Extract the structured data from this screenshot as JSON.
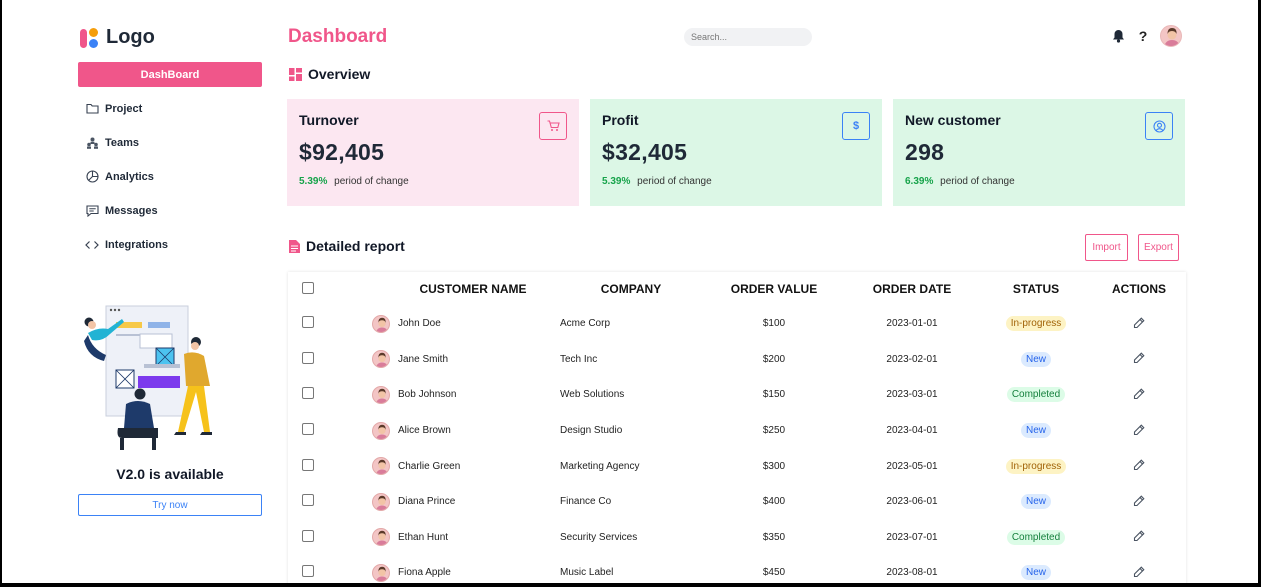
{
  "logo": {
    "text": "Logo"
  },
  "sidebar": {
    "items": [
      {
        "label": "DashBoard",
        "icon": "dashboard-icon",
        "active": true
      },
      {
        "label": "Project",
        "icon": "folder-icon"
      },
      {
        "label": "Teams",
        "icon": "teams-icon"
      },
      {
        "label": "Analytics",
        "icon": "pie-chart-icon"
      },
      {
        "label": "Messages",
        "icon": "message-icon"
      },
      {
        "label": "Integrations",
        "icon": "code-icon"
      }
    ],
    "promo_title": "V2.0 is available",
    "promo_button": "Try now"
  },
  "header": {
    "title": "Dashboard",
    "search_placeholder": "Search...",
    "help_label": "?"
  },
  "overview": {
    "title": "Overview",
    "cards": [
      {
        "title": "Turnover",
        "value": "$92,405",
        "pct": "5.39%",
        "change_label": "period of change",
        "icon": "cart-icon",
        "icon_glyph": "",
        "color": "#fce7f1"
      },
      {
        "title": "Profit",
        "value": "$32,405",
        "pct": "5.39%",
        "change_label": "period of change",
        "icon": "dollar-icon",
        "icon_glyph": "$",
        "color": "#dcf7e6"
      },
      {
        "title": "New customer",
        "value": "298",
        "pct": "6.39%",
        "change_label": "period of change",
        "icon": "user-circle-icon",
        "icon_glyph": "",
        "color": "#dcf7e6"
      }
    ]
  },
  "report": {
    "title": "Detailed report",
    "import_label": "Import",
    "export_label": "Export",
    "columns": {
      "name": "CUSTOMER NAME",
      "company": "COMPANY",
      "value": "ORDER VALUE",
      "date": "ORDER DATE",
      "status": "STATUS",
      "actions": "ACTIONS"
    },
    "rows": [
      {
        "name": "John Doe",
        "company": "Acme Corp",
        "value": "$100",
        "date": "2023-01-01",
        "status": "In-progress"
      },
      {
        "name": "Jane Smith",
        "company": "Tech Inc",
        "value": "$200",
        "date": "2023-02-01",
        "status": "New"
      },
      {
        "name": "Bob Johnson",
        "company": "Web Solutions",
        "value": "$150",
        "date": "2023-03-01",
        "status": "Completed"
      },
      {
        "name": "Alice Brown",
        "company": "Design Studio",
        "value": "$250",
        "date": "2023-04-01",
        "status": "New"
      },
      {
        "name": "Charlie Green",
        "company": "Marketing Agency",
        "value": "$300",
        "date": "2023-05-01",
        "status": "In-progress"
      },
      {
        "name": "Diana Prince",
        "company": "Finance Co",
        "value": "$400",
        "date": "2023-06-01",
        "status": "New"
      },
      {
        "name": "Ethan Hunt",
        "company": "Security Services",
        "value": "$350",
        "date": "2023-07-01",
        "status": "Completed"
      },
      {
        "name": "Fiona Apple",
        "company": "Music Label",
        "value": "$450",
        "date": "2023-08-01",
        "status": "New"
      }
    ]
  },
  "colors": {
    "accent": "#f0568a",
    "success": "#16a34a",
    "link": "#3b82f6"
  }
}
